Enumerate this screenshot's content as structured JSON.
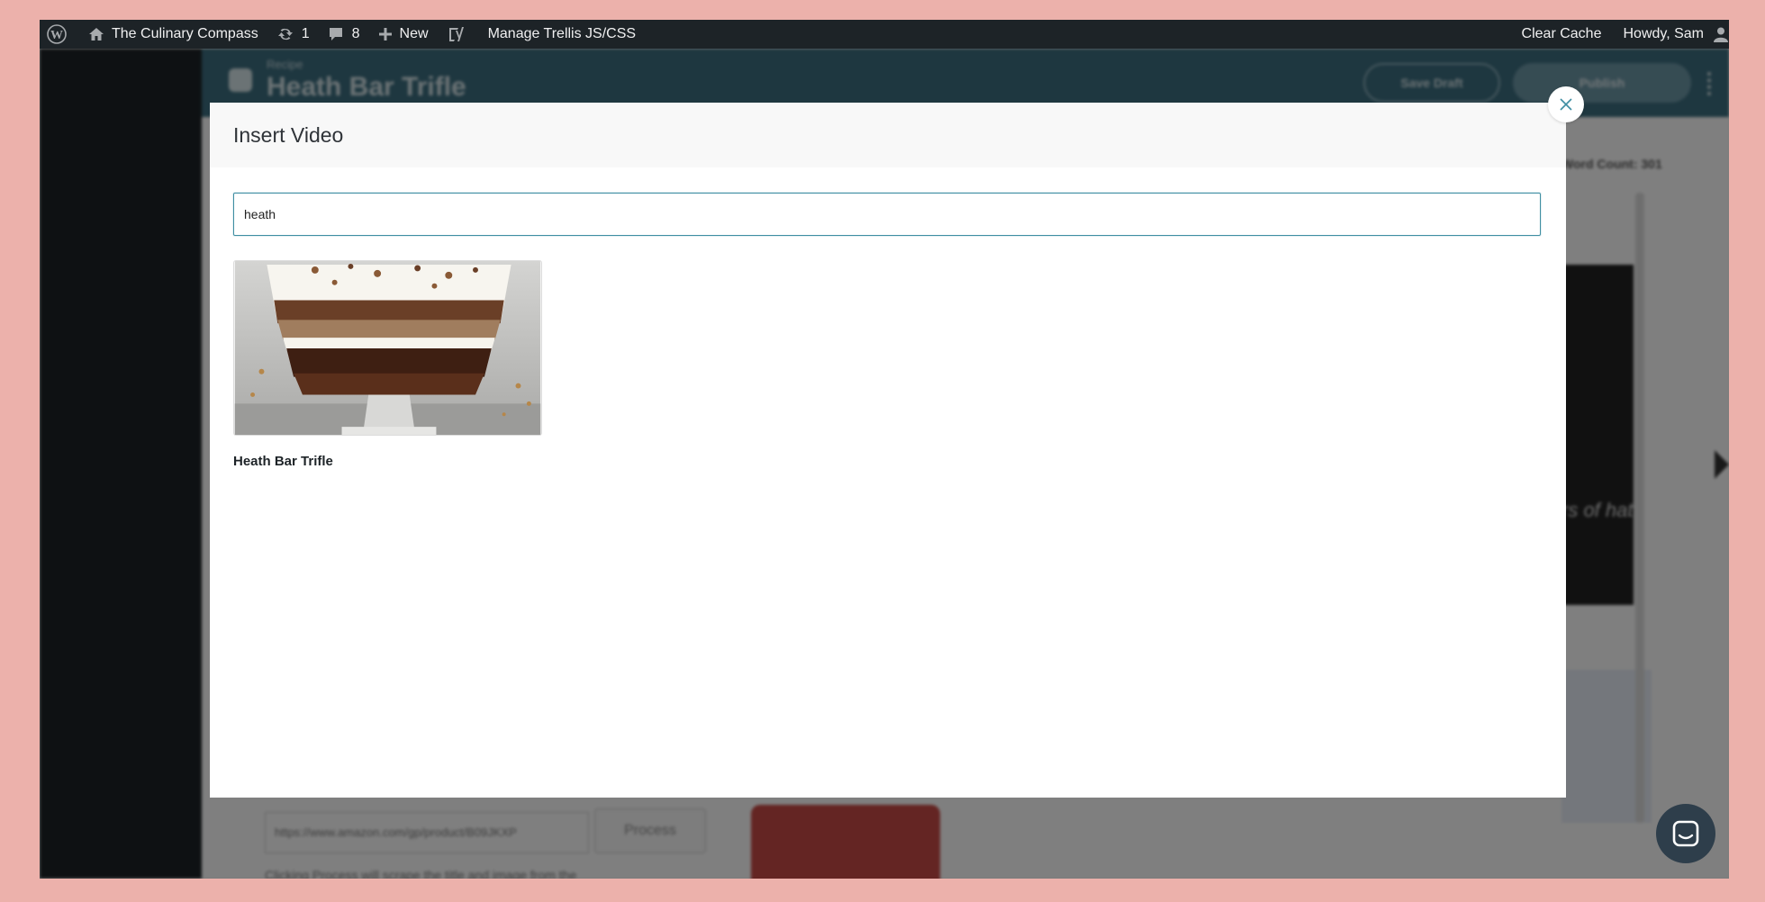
{
  "adminbar": {
    "site_name": "The Culinary Compass",
    "updates_count": "1",
    "comments_count": "8",
    "new_label": "New",
    "manage_label": "Manage Trellis JS/CSS",
    "clear_cache_label": "Clear Cache",
    "howdy_label": "Howdy, Sam"
  },
  "editor": {
    "breadcrumb": "Recipe",
    "title": "Heath Bar Trifle",
    "save_draft_label": "Save Draft",
    "publish_label": "Publish",
    "word_count": "Word Count: 301",
    "url_value": "https://www.amazon.com/gp/product/B09JKXP",
    "process_label": "Process",
    "note_text": "Clicking Process will scrape the title and image from the",
    "dark_text": "rs of hat"
  },
  "modal": {
    "title": "Insert Video",
    "search_value": "heath",
    "results": [
      {
        "title": "Heath Bar Trifle"
      }
    ]
  },
  "icons": {
    "wordpress": "wordpress-icon",
    "home": "home-icon",
    "updates": "refresh-icon",
    "comments": "comment-icon",
    "new": "plus-icon",
    "yoast": "yoast-icon",
    "user": "user-icon",
    "close": "close-icon",
    "chat": "chat-icon"
  },
  "colors": {
    "adminbar_bg": "#1d2327",
    "editor_header": "#3c6e80",
    "input_border": "#3f8ea2",
    "chat_button": "#2e3e4b",
    "page_backdrop": "#ecb1ab"
  }
}
